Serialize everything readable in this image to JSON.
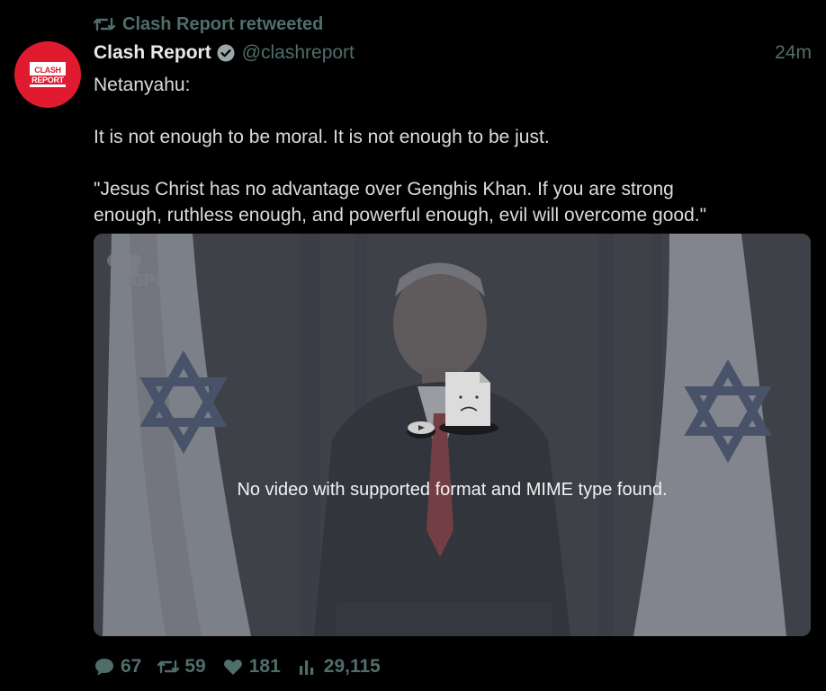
{
  "retweet": {
    "label": "Clash Report retweeted",
    "icon": "retweet-icon"
  },
  "author": {
    "name": "Clash Report",
    "handle": "@clashreport",
    "verified_icon": "verified-badge-icon",
    "avatar_text_line1": "CLASH",
    "avatar_text_line2": "REPORT",
    "avatar_color": "#e01b2f"
  },
  "timestamp": "24m",
  "tweet": {
    "line1": "Netanyahu:",
    "line2": "It is not enough to be moral. It is not enough to be just.",
    "line3": "\"Jesus Christ has no advantage over Genghis Khan. If you are strong",
    "line4": "enough, ruthless enough, and powerful enough, evil will overcome good.\""
  },
  "media": {
    "error_message": "No video with supported format and MIME type found.",
    "watermark": "GPO"
  },
  "stats": {
    "replies": "67",
    "retweets": "59",
    "likes": "181",
    "views": "29,115"
  },
  "colors": {
    "background": "#000000",
    "muted": "#4f6e6a",
    "text": "#e7e9ea"
  }
}
